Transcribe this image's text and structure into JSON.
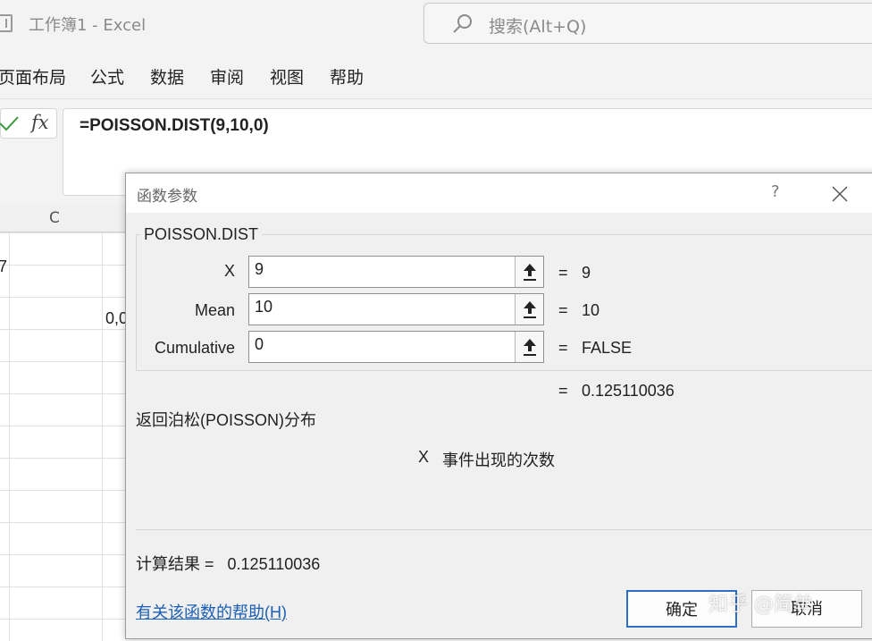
{
  "window": {
    "title": "工作簿1  -  Excel"
  },
  "search": {
    "placeholder": "搜索(Alt+Q)"
  },
  "ribbon": {
    "tabs": [
      "页面布局",
      "公式",
      "数据",
      "审阅",
      "视图",
      "帮助"
    ]
  },
  "formula_bar": {
    "formula": "=POISSON.DIST(9,10,0)"
  },
  "grid": {
    "column_header": "C",
    "cells": [
      {
        "text": "7"
      },
      {
        "text": "0,0"
      }
    ]
  },
  "dialog": {
    "title": "函数参数",
    "help_symbol": "?",
    "function_name": "POISSON.DIST",
    "arguments": [
      {
        "label": "X",
        "value": "9",
        "equals": "=",
        "result": "9"
      },
      {
        "label": "Mean",
        "value": "10",
        "equals": "=",
        "result": "10"
      },
      {
        "label": "Cumulative",
        "value": "0",
        "equals": "=",
        "result": "FALSE"
      }
    ],
    "formula_equals": "=",
    "formula_result": "0.125110036",
    "description": "返回泊松(POISSON)分布",
    "arg_desc_name": "X",
    "arg_desc_text": "事件出现的次数",
    "calc_result_label": "计算结果 =",
    "calc_result_value": "0.125110036",
    "help_link": "有关该函数的帮助(H)",
    "ok_label": "确定",
    "cancel_label": "取消"
  },
  "watermark": "知乎 @简单"
}
